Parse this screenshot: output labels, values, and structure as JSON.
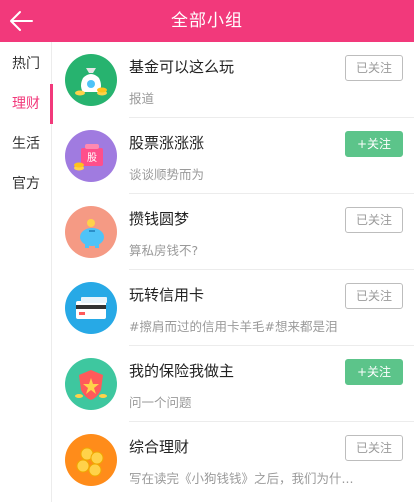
{
  "header": {
    "title": "全部小组",
    "back_icon": "arrow-left-icon",
    "color": "#f2397b"
  },
  "sidebar": {
    "items": [
      {
        "label": "热门",
        "active": false
      },
      {
        "label": "理财",
        "active": true
      },
      {
        "label": "生活",
        "active": false
      },
      {
        "label": "官方",
        "active": false
      }
    ]
  },
  "groups": [
    {
      "name": "基金可以这么玩",
      "desc": "报道",
      "button": "已关注",
      "followed": true,
      "icon": "money-bag-icon",
      "icon_bg": "#27b36f"
    },
    {
      "name": "股票涨涨涨",
      "desc": "谈谈顺势而为",
      "button": "+关注",
      "followed": false,
      "icon": "stock-bag-icon",
      "icon_bg": "#a07be0"
    },
    {
      "name": "攒钱圆梦",
      "desc": "算私房钱不?",
      "button": "已关注",
      "followed": true,
      "icon": "piggy-bank-icon",
      "icon_bg": "#f59a84"
    },
    {
      "name": "玩转信用卡",
      "desc": "#擦肩而过的信用卡羊毛#想来都是泪",
      "button": "已关注",
      "followed": true,
      "icon": "credit-card-icon",
      "icon_bg": "#27a9e6"
    },
    {
      "name": "我的保险我做主",
      "desc": "问一个问题",
      "button": "+关注",
      "followed": false,
      "icon": "insurance-shield-icon",
      "icon_bg": "#3ec79f"
    },
    {
      "name": "综合理财",
      "desc": "写在读完《小狗钱钱》之后，我们为什...",
      "button": "已关注",
      "followed": true,
      "icon": "coins-icon",
      "icon_bg": "#ff8c1a"
    }
  ],
  "colors": {
    "follow_green": "#5cc48a",
    "accent": "#f2397b"
  }
}
